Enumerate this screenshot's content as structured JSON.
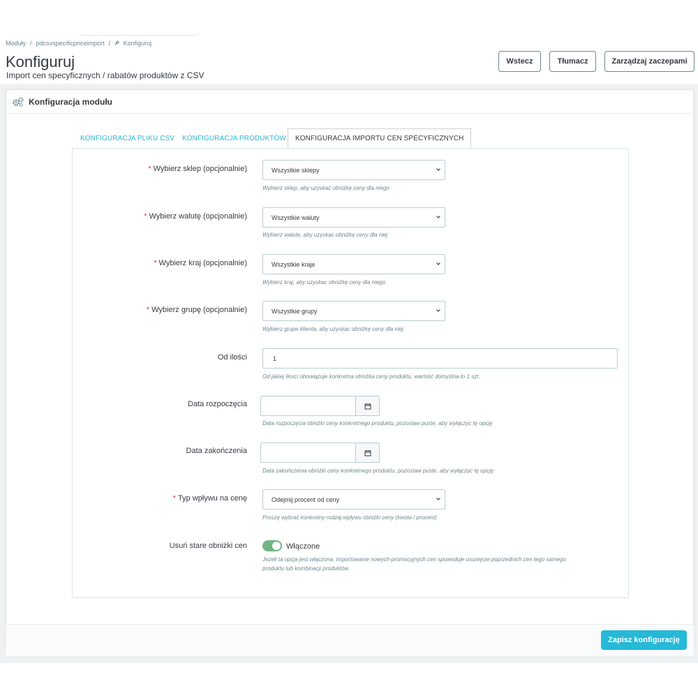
{
  "breadcrumb": {
    "items": [
      "Moduły",
      "pdcsvspecificpriceimport",
      "Konfiguruj"
    ],
    "separator": "/"
  },
  "header": {
    "title": "Konfiguruj",
    "subtitle": "Import cen specyficznych / rabatów produktów z CSV"
  },
  "toolbar": {
    "back_label": "Wstecz",
    "translate_label": "Tłumacz",
    "hooks_label": "Zarządzaj zaczepami"
  },
  "panel": {
    "heading": "Konfiguracja modułu",
    "tabs": [
      {
        "label": "KONFIGURACJA PLIKU CSV",
        "active": false
      },
      {
        "label": "KONFIGURACJA PRODUKTÓW",
        "active": false
      },
      {
        "label": "KONFIGURACJA IMPORTU CEN SPECYFICZNYCH",
        "active": true
      }
    ]
  },
  "form": {
    "required_mark": "*",
    "shop": {
      "label": "Wybierz sklep (opcjonalnie)",
      "value": "Wszystkie sklepy",
      "help": "Wybierz sklep, aby uzyskać obniżkę ceny dla niego"
    },
    "currency": {
      "label": "Wybierz walutę (opcjonalnie)",
      "value": "Wszystkie waluty",
      "help": "Wybierz walute, aby uzyskac obniżkę ceny dla niej"
    },
    "country": {
      "label": "Wybierz kraj (opcjonalnie)",
      "value": "Wszystkie kraje",
      "help": "Wybierz kraj, aby uzyskac obniżkę ceny dla niego"
    },
    "group": {
      "label": "Wybierz grupę (opcjonalnie)",
      "value": "Wszystkie grupy",
      "help": "Wybierz grupe klienta, aby uzyskac obniżkę ceny dla niej"
    },
    "from_quantity": {
      "label": "Od ilości",
      "value": "1",
      "help": "Od jakiej ilosci obowiązuje konkretna obniżka ceny produktu, wartość domyślna to 1 szt."
    },
    "date_from": {
      "label": "Data rozpoczęcia",
      "value": "",
      "help": "Data rozpoczęcia obniżki ceny konkretnego produktu, pozostaw puste, aby wyłączyc tę opcję"
    },
    "date_to": {
      "label": "Data zakończenia",
      "value": "",
      "help": "Data zakończenia obniżki ceny konkretnego produktu, pozostaw puste, aby wyłączyc tę opcję"
    },
    "price_impact": {
      "label": "Typ wpływu na cenę",
      "value": "Odejmij procent od ceny",
      "help": "Proszę wybrać konkretny rodzaj wpływu obniżki ceny (kwota / procent)"
    },
    "delete_old": {
      "label": "Usuń stare obniżki cen",
      "state": "Włączone",
      "enabled": true,
      "help_line1": "Jeżeli ta opcja jest włączona, importowanie nowych promocyjnych cen spowoduje usunięcie poprzednich cen tego samego",
      "help_line2": "produktu lub kombinacji produktów."
    }
  },
  "footer": {
    "save_label": "Zapisz konfigurację"
  },
  "colors": {
    "accent": "#25b9d7",
    "required": "#e2363b",
    "switch_on": "#70b580"
  },
  "icons": [
    "wrench-icon",
    "cogs-icon",
    "chevron-down-icon",
    "calendar-icon"
  ]
}
